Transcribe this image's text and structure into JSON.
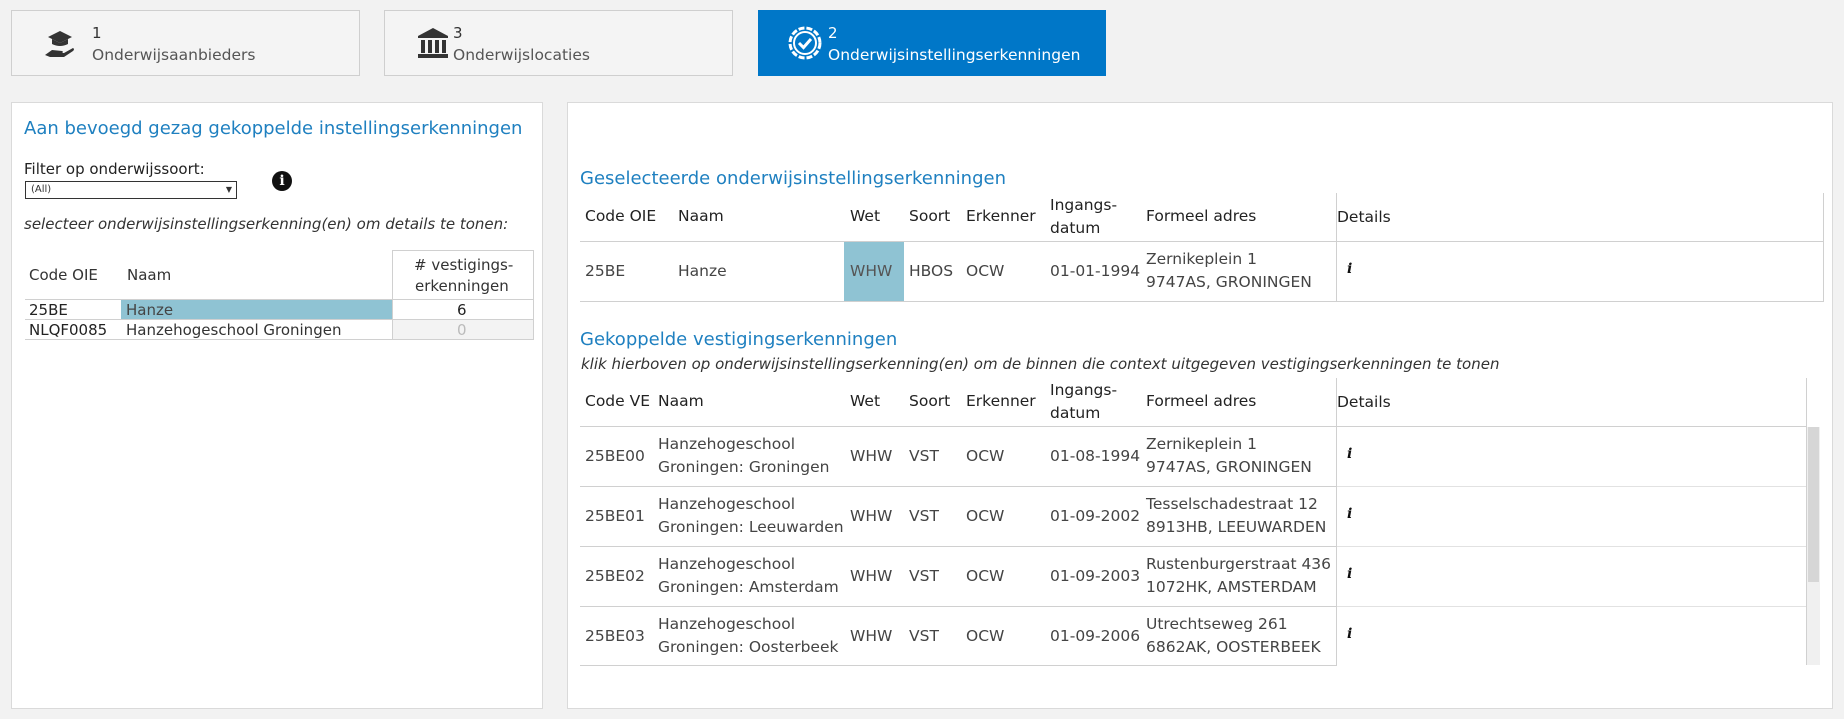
{
  "tabs": [
    {
      "number": "1",
      "label": "Onderwijsaanbieders",
      "icon": "graduation-hand-icon"
    },
    {
      "number": "3",
      "label": "Onderwijslocaties",
      "icon": "building-columns-icon"
    },
    {
      "number": "2",
      "label": "Onderwijsinstellingserkenningen",
      "icon": "badge-check-icon"
    }
  ],
  "left": {
    "title": "Aan bevoegd gezag gekoppelde instellingserkenningen",
    "filter_label": "Filter op onderwijssoort:",
    "filter_value": "(All)",
    "instruction": "selecteer onderwijsinstellingserkenning(en) om details te tonen:",
    "headers": {
      "code": "Code OIE",
      "naam": "Naam",
      "count_line1": "# vestigings-",
      "count_line2": "erkenningen"
    },
    "rows": [
      {
        "code": "25BE",
        "naam": "Hanze",
        "count": "6"
      },
      {
        "code": "NLQF0085",
        "naam": "Hanzehogeschool Groningen",
        "count": "0"
      }
    ]
  },
  "selected": {
    "title": "Geselecteerde onderwijsinstellingserkenningen",
    "headers": {
      "code": "Code OIE",
      "naam": "Naam",
      "wet": "Wet",
      "soort": "Soort",
      "erkenner": "Erkenner",
      "datum1": "Ingangs-",
      "datum2": "datum",
      "adres": "Formeel adres",
      "details": "Details"
    },
    "rows": [
      {
        "code": "25BE",
        "naam": "Hanze",
        "wet": "WHW",
        "soort": "HBOS",
        "erkenner": "OCW",
        "datum": "01-01-1994",
        "adres1": "Zernikeplein 1",
        "adres2": "9747AS, GRONINGEN",
        "details": "i"
      }
    ]
  },
  "vestigingen": {
    "title": "Gekoppelde vestigingserkenningen",
    "subtitle": "klik hierboven op onderwijsinstellingserkenning(en) om de binnen die context uitgegeven vestigingserkenningen te tonen",
    "headers": {
      "code": "Code VE",
      "naam": "Naam",
      "wet": "Wet",
      "soort": "Soort",
      "erkenner": "Erkenner",
      "datum1": "Ingangs-",
      "datum2": "datum",
      "adres": "Formeel adres",
      "details": "Details"
    },
    "rows": [
      {
        "code": "25BE00",
        "naam1": "Hanzehogeschool",
        "naam2": "Groningen: Groningen",
        "wet": "WHW",
        "soort": "VST",
        "erkenner": "OCW",
        "datum": "01-08-1994",
        "adres1": "Zernikeplein 1",
        "adres2": "9747AS, GRONINGEN",
        "details": "i"
      },
      {
        "code": "25BE01",
        "naam1": "Hanzehogeschool",
        "naam2": "Groningen: Leeuwarden",
        "wet": "WHW",
        "soort": "VST",
        "erkenner": "OCW",
        "datum": "01-09-2002",
        "adres1": "Tesselschadestraat 12",
        "adres2": "8913HB, LEEUWARDEN",
        "details": "i"
      },
      {
        "code": "25BE02",
        "naam1": "Hanzehogeschool",
        "naam2": "Groningen: Amsterdam",
        "wet": "WHW",
        "soort": "VST",
        "erkenner": "OCW",
        "datum": "01-09-2003",
        "adres1": "Rustenburgerstraat 436",
        "adres2": "1072HK, AMSTERDAM",
        "details": "i"
      },
      {
        "code": "25BE03",
        "naam1": "Hanzehogeschool",
        "naam2": "Groningen: Oosterbeek",
        "wet": "WHW",
        "soort": "VST",
        "erkenner": "OCW",
        "datum": "01-09-2006",
        "adres1": "Utrechtseweg 261",
        "adres2": "6862AK, OOSTERBEEK",
        "details": "i"
      }
    ]
  },
  "colors": {
    "accent": "#0077c8",
    "title": "#1f80c0",
    "highlight": "#8fc3d3"
  }
}
